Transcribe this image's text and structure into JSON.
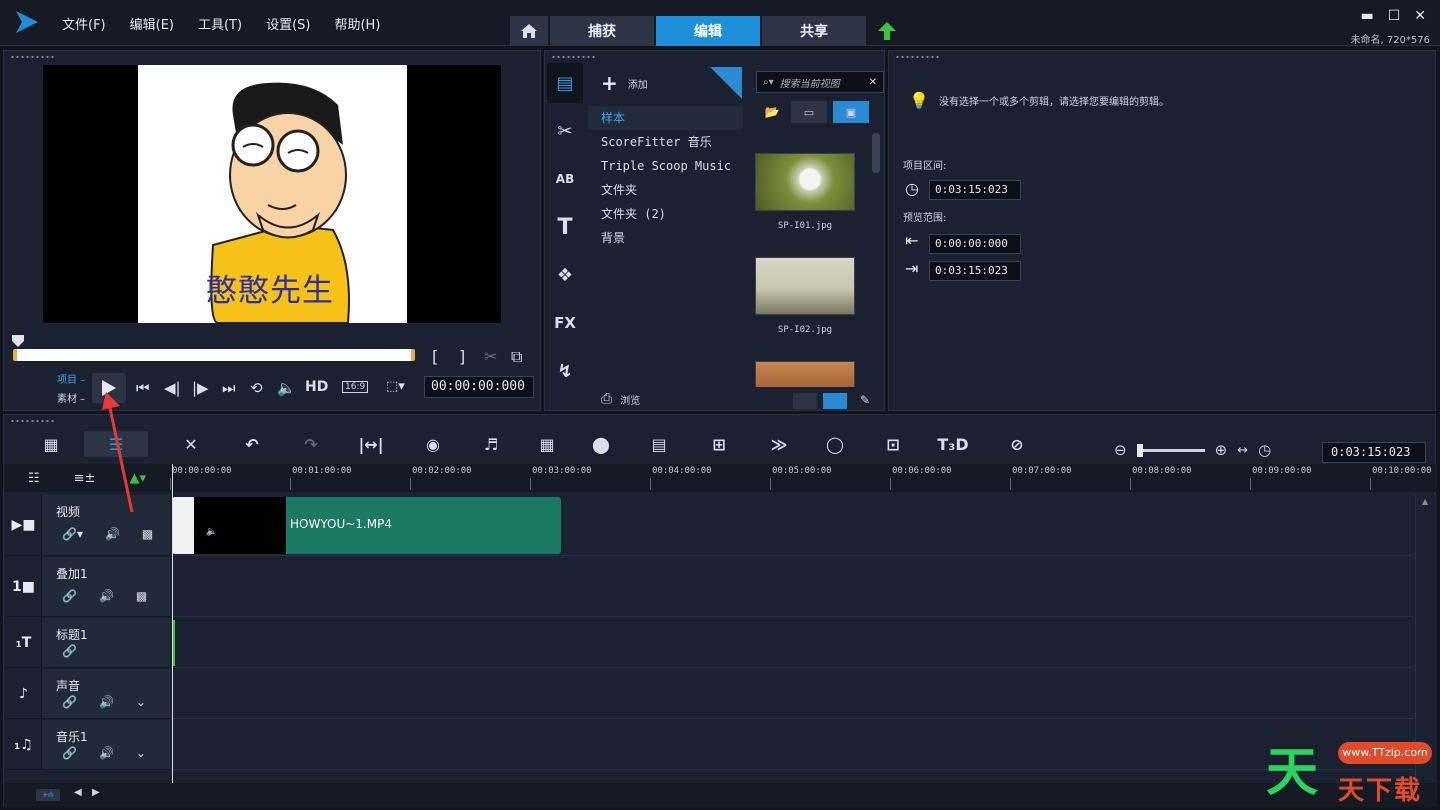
{
  "menu": [
    "文件(F)",
    "编辑(E)",
    "工具(T)",
    "设置(S)",
    "帮助(H)"
  ],
  "tabs": [
    "捕获",
    "编辑",
    "共享"
  ],
  "window": {
    "minimize": "▬",
    "maximize": "☐",
    "close": "✕",
    "project_info": "未命名, 720*576"
  },
  "preview": {
    "caption": "憨憨先生",
    "mode_project": "项目",
    "mode_clip": "素材",
    "hd": "HD",
    "ratio": "16:9",
    "timecode": "00:00:00:000",
    "mark_in": "[",
    "mark_out": "]"
  },
  "library": {
    "add_label": "添加",
    "search_placeholder": "搜索当前视图",
    "folders": [
      "样本",
      "ScoreFitter 音乐",
      "Triple Scoop Music",
      "文件夹",
      "文件夹 (2)",
      "背景"
    ],
    "browse_label": "浏览",
    "thumbnails": [
      {
        "name": "SP-I01.jpg",
        "color": "#8a9a4a"
      },
      {
        "name": "SP-I02.jpg",
        "color": "#b7b79e"
      },
      {
        "name": "",
        "color": "#a86a3c"
      }
    ],
    "side_icons": [
      "media-icon",
      "transition-icon",
      "title-ab-icon",
      "text-icon",
      "graphics-icon",
      "fx-icon",
      "path-icon"
    ],
    "side_labels": [
      "▤",
      "✂",
      "AB",
      "T",
      "❖",
      "FX",
      "↯"
    ]
  },
  "options": {
    "hint": "没有选择一个或多个剪辑，请选择您要编辑的剪辑。",
    "project_duration_label": "项目区间:",
    "project_duration": "0:03:15:023",
    "preview_range_label": "预览范围:",
    "range_start": "0:00:00:000",
    "range_end": "0:03:15:023"
  },
  "timeline": {
    "time": "0:03:15:023",
    "ruler": [
      "00:00:00:00",
      "00:01:00:00",
      "00:02:00:00",
      "00:03:00:00",
      "00:04:00:00",
      "00:05:00:00",
      "00:06:00:00",
      "00:07:00:00",
      "00:08:00:00",
      "00:09:00:00",
      "00:10:00:00"
    ],
    "tracks": [
      {
        "name": "视频",
        "icon": "▶■"
      },
      {
        "name": "叠加1",
        "icon": "1■"
      },
      {
        "name": "标题1",
        "icon": "₁T"
      },
      {
        "name": "声音",
        "icon": "♪"
      },
      {
        "name": "音乐1",
        "icon": "₁♫"
      }
    ],
    "video_clip": "HOWYOU~1.MP4"
  },
  "watermark": {
    "big": "天",
    "pill": "www.TTzip.com",
    "small": "天下载"
  },
  "colors": {
    "accent": "#1d8fd8",
    "clip": "#1a7a63",
    "annotation": "#e53935"
  }
}
